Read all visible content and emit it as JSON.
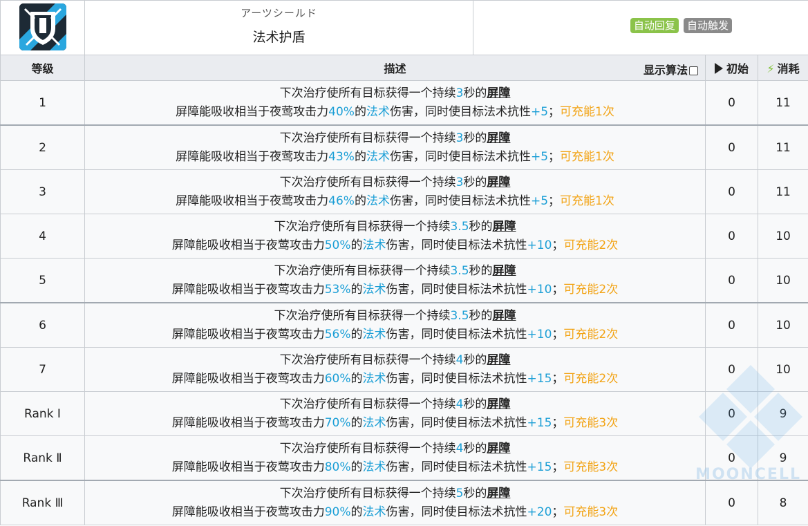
{
  "skill": {
    "icon": "shield-spear-icon",
    "name_jp": "アーツシールド",
    "name_cn": "法术护盾",
    "tags": [
      {
        "label": "自动回复",
        "color": "#8bc34a"
      },
      {
        "label": "自动触发",
        "color": "#8a8a8a"
      }
    ]
  },
  "header": {
    "level": "等级",
    "description": "描述",
    "show_formula": "显示算法",
    "initial": "初始",
    "cost": "消耗"
  },
  "rows": [
    {
      "level": "1",
      "line1_pre": "下次治疗使所有目标获得一个持续",
      "dur": "3",
      "line1_post": "秒的",
      "key": "屏障",
      "line2_pre": "屏障能吸收相当于夜莺攻击力",
      "pct": "40%",
      "mid": "的",
      "arts": "法术",
      "line2_mid": "伤害，同时使目标法术抗性",
      "res": "+5",
      "semi": "；",
      "charge": "可充能1次",
      "initial": "0",
      "cost": "11"
    },
    {
      "level": "2",
      "line1_pre": "下次治疗使所有目标获得一个持续",
      "dur": "3",
      "line1_post": "秒的",
      "key": "屏障",
      "line2_pre": "屏障能吸收相当于夜莺攻击力",
      "pct": "43%",
      "mid": "的",
      "arts": "法术",
      "line2_mid": "伤害，同时使目标法术抗性",
      "res": "+5",
      "semi": "；",
      "charge": "可充能1次",
      "initial": "0",
      "cost": "11"
    },
    {
      "level": "3",
      "line1_pre": "下次治疗使所有目标获得一个持续",
      "dur": "3",
      "line1_post": "秒的",
      "key": "屏障",
      "line2_pre": "屏障能吸收相当于夜莺攻击力",
      "pct": "46%",
      "mid": "的",
      "arts": "法术",
      "line2_mid": "伤害，同时使目标法术抗性",
      "res": "+5",
      "semi": "；",
      "charge": "可充能1次",
      "initial": "0",
      "cost": "11"
    },
    {
      "level": "4",
      "line1_pre": "下次治疗使所有目标获得一个持续",
      "dur": "3.5",
      "line1_post": "秒的",
      "key": "屏障",
      "line2_pre": "屏障能吸收相当于夜莺攻击力",
      "pct": "50%",
      "mid": "的",
      "arts": "法术",
      "line2_mid": "伤害，同时使目标法术抗性",
      "res": "+10",
      "semi": "；",
      "charge": "可充能2次",
      "initial": "0",
      "cost": "10"
    },
    {
      "level": "5",
      "line1_pre": "下次治疗使所有目标获得一个持续",
      "dur": "3.5",
      "line1_post": "秒的",
      "key": "屏障",
      "line2_pre": "屏障能吸收相当于夜莺攻击力",
      "pct": "53%",
      "mid": "的",
      "arts": "法术",
      "line2_mid": "伤害，同时使目标法术抗性",
      "res": "+10",
      "semi": "；",
      "charge": "可充能2次",
      "initial": "0",
      "cost": "10"
    },
    {
      "level": "6",
      "line1_pre": "下次治疗使所有目标获得一个持续",
      "dur": "3.5",
      "line1_post": "秒的",
      "key": "屏障",
      "line2_pre": "屏障能吸收相当于夜莺攻击力",
      "pct": "56%",
      "mid": "的",
      "arts": "法术",
      "line2_mid": "伤害，同时使目标法术抗性",
      "res": "+10",
      "semi": "；",
      "charge": "可充能2次",
      "initial": "0",
      "cost": "10"
    },
    {
      "level": "7",
      "line1_pre": "下次治疗使所有目标获得一个持续",
      "dur": "4",
      "line1_post": "秒的",
      "key": "屏障",
      "line2_pre": "屏障能吸收相当于夜莺攻击力",
      "pct": "60%",
      "mid": "的",
      "arts": "法术",
      "line2_mid": "伤害，同时使目标法术抗性",
      "res": "+15",
      "semi": "；",
      "charge": "可充能2次",
      "initial": "0",
      "cost": "10"
    },
    {
      "level": "Rank Ⅰ",
      "line1_pre": "下次治疗使所有目标获得一个持续",
      "dur": "4",
      "line1_post": "秒的",
      "key": "屏障",
      "line2_pre": "屏障能吸收相当于夜莺攻击力",
      "pct": "70%",
      "mid": "的",
      "arts": "法术",
      "line2_mid": "伤害，同时使目标法术抗性",
      "res": "+15",
      "semi": "；",
      "charge": "可充能3次",
      "initial": "0",
      "cost": "9"
    },
    {
      "level": "Rank Ⅱ",
      "line1_pre": "下次治疗使所有目标获得一个持续",
      "dur": "4",
      "line1_post": "秒的",
      "key": "屏障",
      "line2_pre": "屏障能吸收相当于夜莺攻击力",
      "pct": "80%",
      "mid": "的",
      "arts": "法术",
      "line2_mid": "伤害，同时使目标法术抗性",
      "res": "+15",
      "semi": "；",
      "charge": "可充能3次",
      "initial": "0",
      "cost": "9"
    },
    {
      "level": "Rank Ⅲ",
      "line1_pre": "下次治疗使所有目标获得一个持续",
      "dur": "5",
      "line1_post": "秒的",
      "key": "屏障",
      "line2_pre": "屏障能吸收相当于夜莺攻击力",
      "pct": "90%",
      "mid": "的",
      "arts": "法术",
      "line2_mid": "伤害，同时使目标法术抗性",
      "res": "+20",
      "semi": "；",
      "charge": "可充能3次",
      "initial": "0",
      "cost": "8"
    }
  ],
  "separators_after": [
    0,
    4,
    8
  ],
  "watermark": "MOONCELL"
}
